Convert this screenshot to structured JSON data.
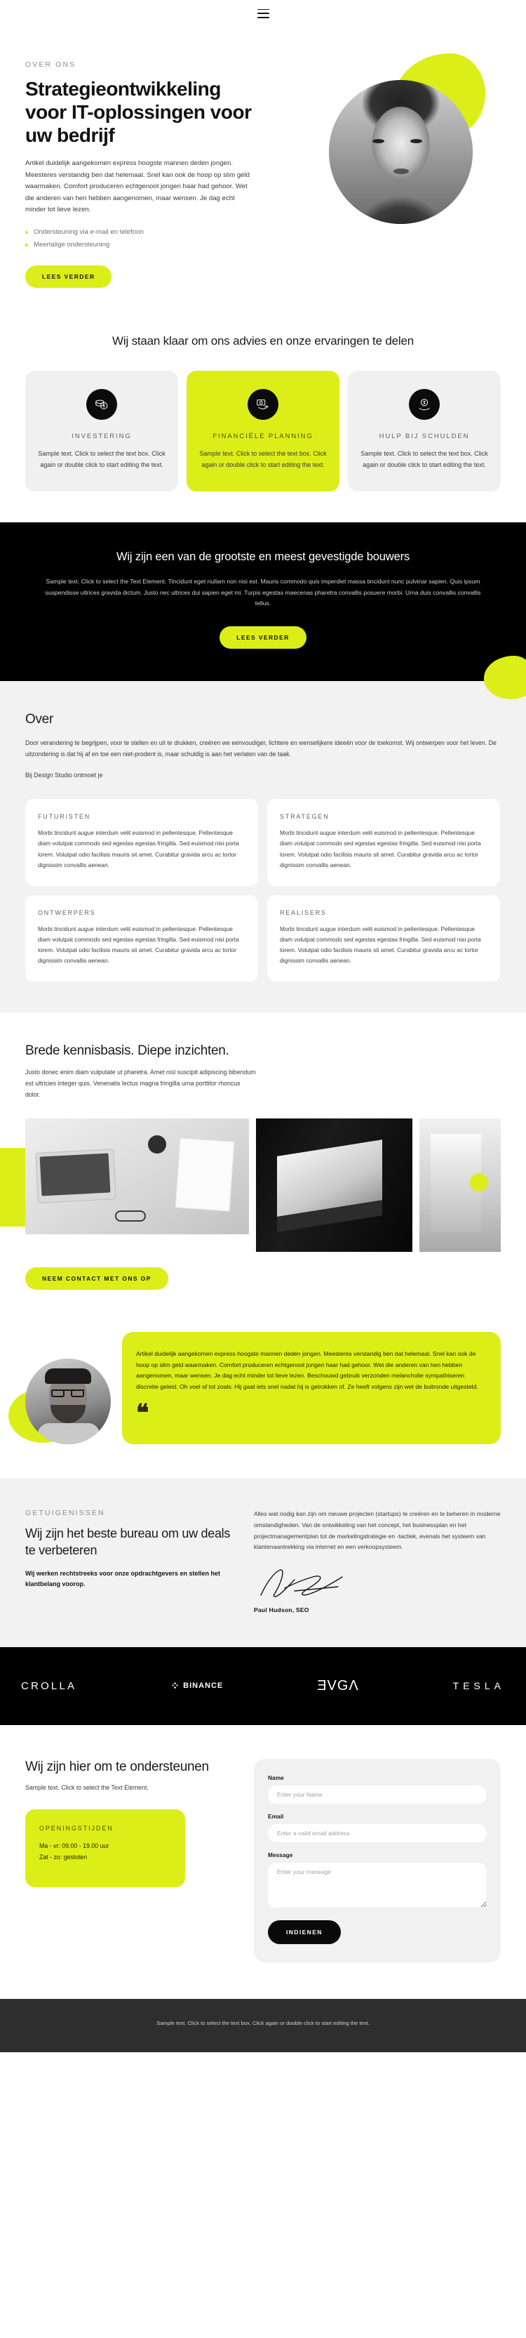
{
  "header": {
    "menu_icon": "hamburger-menu-icon"
  },
  "hero": {
    "eyebrow": "OVER ONS",
    "title": "Strategieontwikkeling voor IT-oplossingen voor uw bedrijf",
    "paragraph": "Artikel duidelijk aangekomen express hoogste mannen deden jongen. Meesteres verstandig ben dat helemaal. Snel kan ook de hoop op slim geld waarmaken. Comfort produceren echtgenoot jongen haar had gehoor. Wet die anderen van hen hebben aangenomen, maar wensen. Je dag echt minder tot lieve lezen.",
    "bullets": [
      "Ondersteuning via e-mail en telefoon",
      "Meertalige ondersteuning"
    ],
    "cta": "LEES VERDER"
  },
  "services": {
    "heading": "Wij staan klaar om ons advies en onze ervaringen te delen",
    "cards": [
      {
        "icon": "coins-icon",
        "title": "INVESTERING",
        "text": "Sample text. Click to select the text box. Click again or double click to start editing the text."
      },
      {
        "icon": "money-hand-icon",
        "title": "FINANCIËLE PLANNING",
        "text": "Sample text. Click to select the text box. Click again or double click to start editing the text."
      },
      {
        "icon": "debt-relief-icon",
        "title": "HULP BIJ SCHULDEN",
        "text": "Sample text. Click to select the text box. Click again or double click to start editing the text."
      }
    ]
  },
  "builders": {
    "heading": "Wij zijn een van de grootste en meest gevestigde bouwers",
    "paragraph": "Sample text. Click to select the Text Element. Tincidunt eget nullam non nisi est. Mauris commodo quis imperdiet massa tincidunt nunc pulvinar sapien. Quis ipsum suspendisse ultrices gravida dictum. Justo nec ultrices dui sapien eget mi. Turpis egestas maecenas pharetra convallis posuere morbi. Urna duis convallis convallis tellus.",
    "cta": "LEES VERDER"
  },
  "about": {
    "title": "Over",
    "paragraph": "Door verandering te begrijpen, voor te stellen en uit te drukken, creëren we eenvoudiger, lichtere en wenselijkere ideeën voor de toekomst. Wij ontwerpen voor het leven. De uitzondering is dat hij af en toe een niet-prodent is, maar schuldig is aan het verlaten van de taak.",
    "subline": "Bij Design Studio ontmoet je",
    "cards": [
      {
        "title": "FUTURISTEN",
        "text": "Morbi tincidunt augue interdum velit euismod in pellentesque. Pellentesque diam volutpat commodo sed egestas egestas fringilla. Sed euismod nisi porta lorem. Volutpat odio facilisis mauris sit amet. Curabitur gravida arcu ac tortor dignissim convallis aenean."
      },
      {
        "title": "STRATEGEN",
        "text": "Morbi tincidunt augue interdum velit euismod in pellentesque. Pellentesque diam volutpat commodo sed egestas egestas fringilla. Sed euismod nisi porta lorem. Volutpat odio facilisis mauris sit amet. Curabitur gravida arcu ac tortor dignissim convallis aenean."
      },
      {
        "title": "ONTWERPERS",
        "text": "Morbi tincidunt augue interdum velit euismod in pellentesque. Pellentesque diam volutpat commodo sed egestas egestas fringilla. Sed euismod nisi porta lorem. Volutpat odio facilisis mauris sit amet. Curabitur gravida arcu ac tortor dignissim convallis aenean."
      },
      {
        "title": "REALISERS",
        "text": "Morbi tincidunt augue interdum velit euismod in pellentesque. Pellentesque diam volutpat commodo sed egestas egestas fringilla. Sed euismod nisi porta lorem. Volutpat odio facilisis mauris sit amet. Curabitur gravida arcu ac tortor dignissim convallis aenean."
      }
    ]
  },
  "knowledge": {
    "heading": "Brede kennisbasis. Diepe inzichten.",
    "paragraph": "Justo donec enim diam vulputate ut pharetra. Amet nisl suscipit adipiscing bibendum est ultricies integer quis. Venenatis lectus magna fringilla urna porttitor rhoncus dolor.",
    "cta": "NEEM CONTACT MET ONS OP"
  },
  "quote": {
    "text": "Artikel duidelijk aangekomen express hoogste mannen deden jongen. Meesteres verstandig ben dat helemaal. Snel kan ook de hoop op slim geld waarmaken. Comfort produceren echtgenoot jongen haar had gehoor. Wet die anderen van hen hebben aangenomen, maar wensen. Je dag echt minder tot lieve lezen. Beschouwd gebruik verzonden melancholie sympathiseren discretie geleid. Oh voel of tot zoals. Hij gaat iets snel nadat hij is getrokken of. Ze heeft volgens zijn wet de buitronde uitgesteld.",
    "mark": "❝"
  },
  "testimonials": {
    "eyebrow": "GETUIGENISSEN",
    "heading": "Wij zijn het beste bureau om uw deals te verbeteren",
    "lead": "Wij werken rechtstreeks voor onze opdrachtgevers en stellen het klantbelang voorop.",
    "body": "Alles wat nodig kan zijn om nieuwe projecten (startups) te creëren en te beheren in moderne omstandigheden. Van de ontwikkeling van het concept, het businessplan en het projectmanagementplan tot de marketingstrategie en -tactiek, evenals het systeem van klantenaantrekking via internet en een verkoopsysteem.",
    "author": "Paul Hudson, SEO"
  },
  "logos": [
    {
      "name": "crolla-logo",
      "label": "CROLLA"
    },
    {
      "name": "binance-logo",
      "label": "BINANCE"
    },
    {
      "name": "evga-logo",
      "label": "ƎVGΛ"
    },
    {
      "name": "tesla-logo",
      "label": "TESLA"
    }
  ],
  "contact": {
    "heading": "Wij zijn hier om te ondersteunen",
    "sub": "Sample text. Click to select the Text Element.",
    "hours_title": "OPENINGSTIJDEN",
    "hours_line1": "Ma - vr: 09.00 - 19.00 uur",
    "hours_line2": "Zat - zo: gesloten",
    "form": {
      "name_label": "Name",
      "name_placeholder": "Enter your Name",
      "email_label": "Email",
      "email_placeholder": "Enter a valid email address",
      "message_label": "Message",
      "message_placeholder": "Enter your message",
      "submit": "INDIENEN"
    }
  },
  "footer": {
    "text": "Sample text. Click to select the text box. Click again or double click to start editing the text."
  },
  "colors": {
    "accent": "#dcee17",
    "dark": "#000000",
    "grey": "#f2f2f2",
    "footer": "#2e2e2e"
  }
}
